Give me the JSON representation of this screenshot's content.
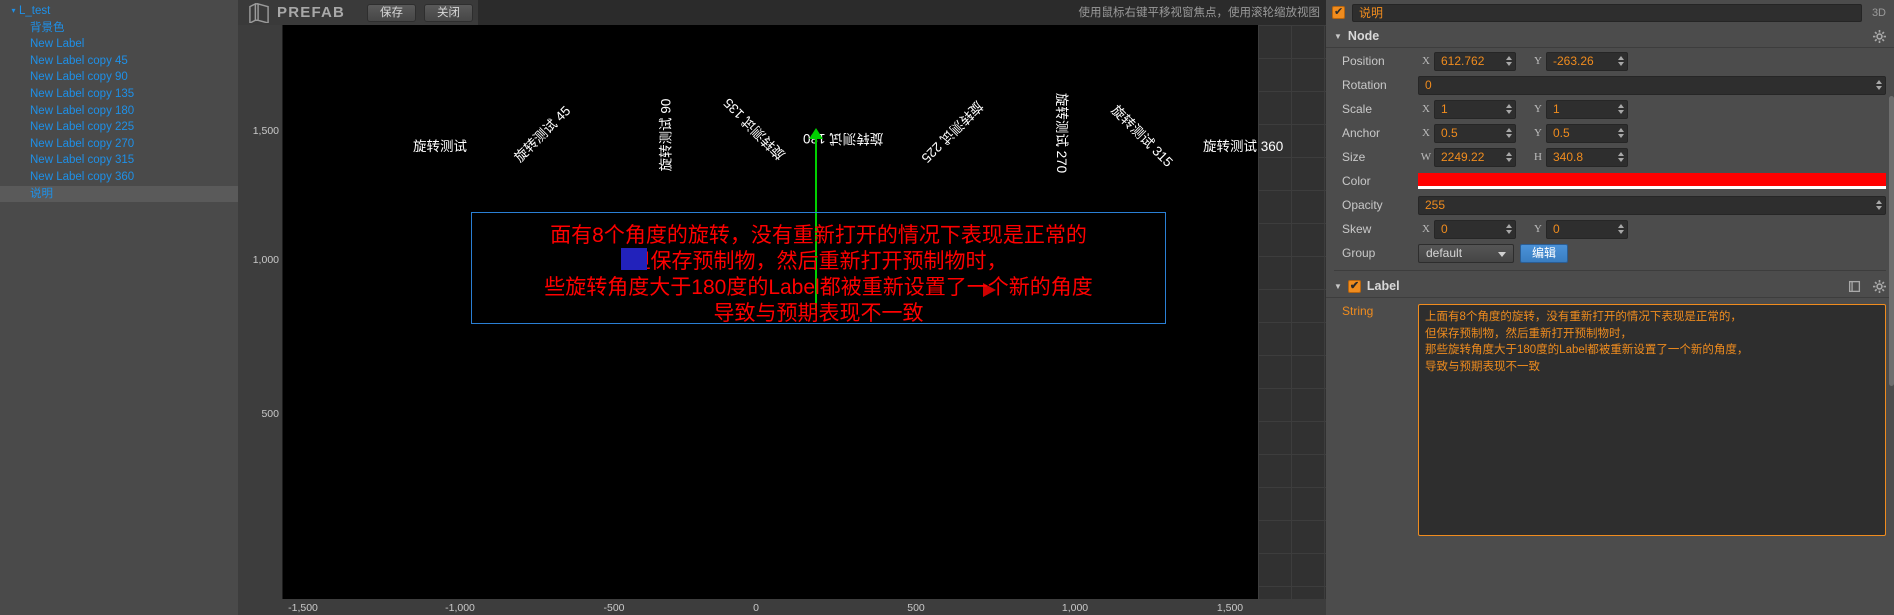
{
  "tree": {
    "root": {
      "label": "L_test",
      "twisty": "▾"
    },
    "items": [
      {
        "label": "背景色",
        "selected": false
      },
      {
        "label": "New Label",
        "selected": false
      },
      {
        "label": "New Label copy 45",
        "selected": false
      },
      {
        "label": "New Label copy 90",
        "selected": false
      },
      {
        "label": "New Label copy 135",
        "selected": false
      },
      {
        "label": "New Label copy 180",
        "selected": false
      },
      {
        "label": "New Label copy 225",
        "selected": false
      },
      {
        "label": "New Label copy 270",
        "selected": false
      },
      {
        "label": "New Label copy 315",
        "selected": false
      },
      {
        "label": "New Label copy 360",
        "selected": false
      },
      {
        "label": "说明",
        "selected": true
      }
    ]
  },
  "toolbar": {
    "title": "PREFAB",
    "save_label": "保存",
    "close_label": "关闭",
    "hint": "使用鼠标右键平移视窗焦点，使用滚轮缩放视图"
  },
  "canvas": {
    "ruler_v": [
      "1,500",
      "1,000",
      "500"
    ],
    "ruler_h": [
      "-1,500",
      "-1,000",
      "-500",
      "0",
      "500",
      "1,000",
      "1,500"
    ],
    "scene_labels": [
      {
        "text": "旋转测试",
        "angle": 0
      },
      {
        "text": "旋转测试 45",
        "angle": -45
      },
      {
        "text": "旋转测试 90",
        "angle": -90
      },
      {
        "text": "旋转测试 135",
        "angle": -135
      },
      {
        "text": "旋转测试 180",
        "angle": 180
      },
      {
        "text": "旋转测试 225",
        "angle": 135
      },
      {
        "text": "旋转测试 270",
        "angle": 90
      },
      {
        "text": "旋转测试 315",
        "angle": 45
      },
      {
        "text": "旋转测试 360",
        "angle": 0
      }
    ],
    "red_text_lines": [
      "面有8个角度的旋转，没有重新打开的情况下表现是正常的",
      "但保存预制物，然后重新打开预制物时，",
      "些旋转角度大于180度的Label都被重新设置了一个新的角度",
      "导致与预期表现不一致"
    ]
  },
  "inspector": {
    "node_name": "说明",
    "enabled": true,
    "badge_3d": "3D",
    "node_section": {
      "title": "Node",
      "expanded": true
    },
    "properties": {
      "position": {
        "label": "Position",
        "x_tag": "X",
        "x": "612.762",
        "y_tag": "Y",
        "y": "-263.26"
      },
      "rotation": {
        "label": "Rotation",
        "value": "0"
      },
      "scale": {
        "label": "Scale",
        "x_tag": "X",
        "x": "1",
        "y_tag": "Y",
        "y": "1"
      },
      "anchor": {
        "label": "Anchor",
        "x_tag": "X",
        "x": "0.5",
        "y_tag": "Y",
        "y": "0.5"
      },
      "size": {
        "label": "Size",
        "w_tag": "W",
        "w": "2249.22",
        "h_tag": "H",
        "h": "340.8"
      },
      "color": {
        "label": "Color",
        "value": "#FF0000"
      },
      "opacity": {
        "label": "Opacity",
        "value": "255"
      },
      "skew": {
        "label": "Skew",
        "x_tag": "X",
        "x": "0",
        "y_tag": "Y",
        "y": "0"
      },
      "group": {
        "label": "Group",
        "value": "default",
        "edit_label": "编辑"
      }
    },
    "label_section": {
      "title": "Label",
      "expanded": true,
      "enabled": true
    },
    "string": {
      "label": "String",
      "value": "上面有8个角度的旋转，没有重新打开的情况下表现是正常的，\n但保存预制物，然后重新打开预制物时，\n那些旋转角度大于180度的Label都被重新设置了一个新的角度，\n导致与预期表现不一致"
    }
  },
  "colors": {
    "accent_orange": "#f08c1e",
    "tree_blue": "#1e90e8",
    "selection_blue": "#2a7fd4",
    "red": "#ff0000",
    "green": "#00d000"
  }
}
